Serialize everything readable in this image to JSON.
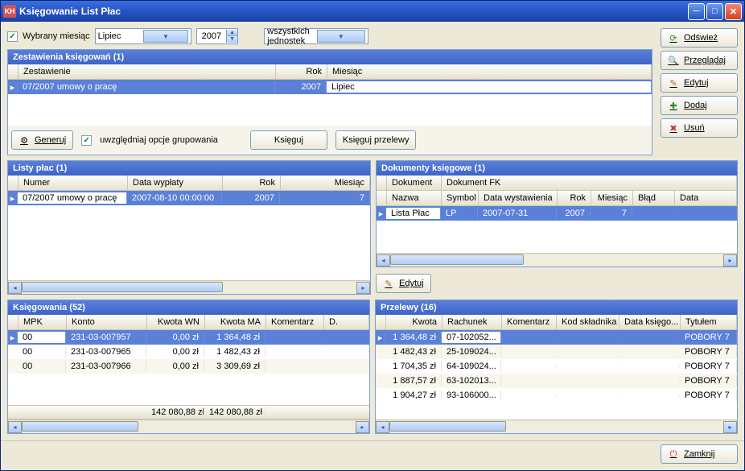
{
  "window": {
    "title": "Księgowanie List Płac"
  },
  "filter": {
    "checkbox_label": "Wybrany miesiąc",
    "month": "Lipiec",
    "year": "2007",
    "units": "wszystkich jednostek"
  },
  "sidebuttons": {
    "refresh": "Odśwież",
    "browse": "Przeglądaj",
    "edit": "Edytuj",
    "add": "Dodaj",
    "delete": "Usuń"
  },
  "zestawienia": {
    "title": "Zestawienia księgowań (1)",
    "cols": {
      "zestawienie": "Zestawienie",
      "rok": "Rok",
      "miesiac": "Miesiąc"
    },
    "rows": [
      {
        "zestawienie": "07/2007 umowy o pracę",
        "rok": "2007",
        "miesiac": "Lipiec"
      }
    ],
    "actions": {
      "generuj": "Generuj",
      "grupowanie": "uwzględniaj opcje grupowania",
      "ksieguj": "Księguj",
      "ksieguj_przelewy": "Księguj przelewy"
    }
  },
  "listy": {
    "title": "Listy płac (1)",
    "cols": {
      "numer": "Numer",
      "data": "Data wypłaty",
      "rok": "Rok",
      "miesiac": "Miesiąc"
    },
    "rows": [
      {
        "numer": "07/2007 umowy o pracę",
        "data": "2007-08-10 00:00:00",
        "rok": "2007",
        "miesiac": "7"
      }
    ]
  },
  "dokumenty": {
    "title": "Dokumenty księgowe (1)",
    "groupcols": {
      "dokument": "Dokument",
      "dokumentfk": "Dokument FK"
    },
    "cols": {
      "nazwa": "Nazwa",
      "symbol": "Symbol",
      "data": "Data wystawienia",
      "rok": "Rok",
      "miesiac": "Miesiąc",
      "blad": "Błąd",
      "data2": "Data"
    },
    "rows": [
      {
        "nazwa": "Lista Płac",
        "symbol": "LP",
        "data": "2007-07-31",
        "rok": "2007",
        "miesiac": "7",
        "blad": "",
        "data2": ""
      }
    ],
    "edit": "Edytuj"
  },
  "ksiegowania": {
    "title": "Księgowania (52)",
    "cols": {
      "mpk": "MPK",
      "konto": "Konto",
      "wn": "Kwota WN",
      "ma": "Kwota MA",
      "komentarz": "Komentarz",
      "d": "D."
    },
    "rows": [
      {
        "mpk": "00",
        "konto": "231-03-007957",
        "wn": "0,00 zł",
        "ma": "1 364,48 zł",
        "komentarz": "",
        "d": ""
      },
      {
        "mpk": "00",
        "konto": "231-03-007965",
        "wn": "0,00 zł",
        "ma": "1 482,43 zł",
        "komentarz": "",
        "d": ""
      },
      {
        "mpk": "00",
        "konto": "231-03-007966",
        "wn": "0,00 zł",
        "ma": "3 309,69 zł",
        "komentarz": "",
        "d": ""
      }
    ],
    "sum": {
      "wn": "142 080,88 zł",
      "ma": "142 080,88 zł"
    }
  },
  "przelewy": {
    "title": "Przelewy (16)",
    "cols": {
      "kwota": "Kwota",
      "rachunek": "Rachunek",
      "komentarz": "Komentarz",
      "kod": "Kod składnika",
      "dataks": "Data księgo...",
      "tytulem": "Tytułem"
    },
    "rows": [
      {
        "kwota": "1 364,48 zł",
        "rachunek": "07-102052...",
        "komentarz": "",
        "kod": "",
        "dataks": "",
        "tytulem": "POBORY 7"
      },
      {
        "kwota": "1 482,43 zł",
        "rachunek": "25-109024...",
        "komentarz": "",
        "kod": "",
        "dataks": "",
        "tytulem": "POBORY 7"
      },
      {
        "kwota": "1 704,35 zł",
        "rachunek": "64-109024...",
        "komentarz": "",
        "kod": "",
        "dataks": "",
        "tytulem": "POBORY 7"
      },
      {
        "kwota": "1 887,57 zł",
        "rachunek": "63-102013...",
        "komentarz": "",
        "kod": "",
        "dataks": "",
        "tytulem": "POBORY 7"
      },
      {
        "kwota": "1 904,27 zł",
        "rachunek": "93-106000...",
        "komentarz": "",
        "kod": "",
        "dataks": "",
        "tytulem": "POBORY 7"
      }
    ]
  },
  "footer": {
    "close": "Zamknij"
  }
}
